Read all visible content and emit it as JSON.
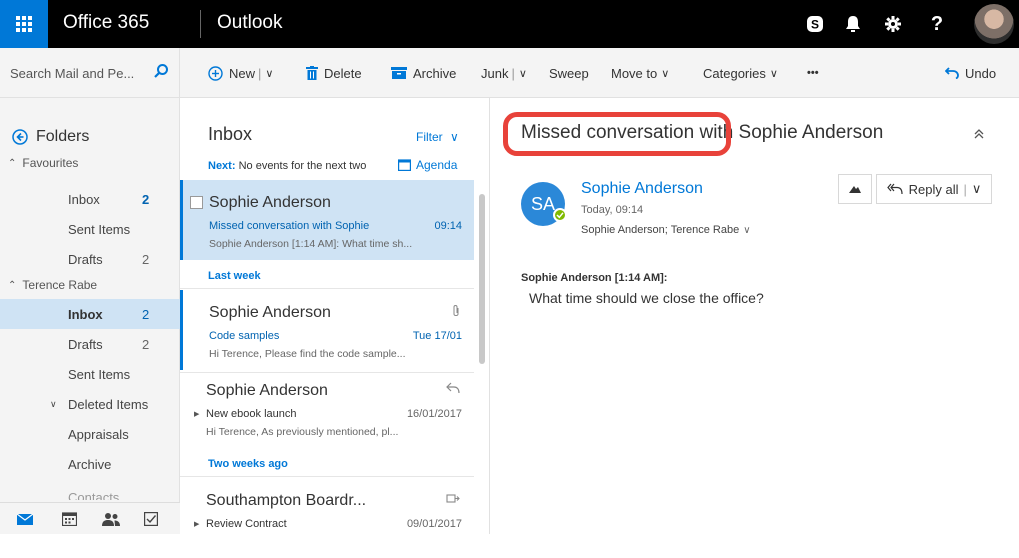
{
  "topbar": {
    "brand": "Office 365",
    "app": "Outlook",
    "icons": [
      "skype-icon",
      "bell-icon",
      "gear-icon",
      "help-icon"
    ],
    "help_label": "?"
  },
  "search": {
    "placeholder": "Search Mail and Pe..."
  },
  "commands": {
    "new": "New",
    "delete": "Delete",
    "archive": "Archive",
    "junk": "Junk",
    "sweep": "Sweep",
    "move_to": "Move to",
    "categories": "Categories",
    "more": "•••",
    "undo": "Undo"
  },
  "nav": {
    "folders_label": "Folders",
    "favourites": {
      "label": "Favourites",
      "items": [
        {
          "label": "Inbox",
          "count": "2"
        },
        {
          "label": "Sent Items",
          "count": ""
        },
        {
          "label": "Drafts",
          "count": "2"
        }
      ]
    },
    "account": {
      "label": "Terence Rabe",
      "items": [
        {
          "label": "Inbox",
          "count": "2"
        },
        {
          "label": "Drafts",
          "count": "2"
        },
        {
          "label": "Sent Items",
          "count": ""
        },
        {
          "label": "Deleted Items",
          "count": ""
        },
        {
          "label": "Appraisals",
          "count": ""
        },
        {
          "label": "Archive",
          "count": ""
        },
        {
          "label": "Contacts",
          "count": ""
        }
      ]
    }
  },
  "list": {
    "title": "Inbox",
    "filter": "Filter",
    "next_label": "Next:",
    "next_text": "No events for the next two",
    "agenda": "Agenda",
    "sections": [
      "Last week",
      "Two weeks ago"
    ],
    "messages": [
      {
        "from": "Sophie Anderson",
        "subject": "Missed conversation with Sophie",
        "time": "09:14",
        "preview": "Sophie Anderson [1:14 AM]: What time sh..."
      },
      {
        "from": "Sophie Anderson",
        "subject": "Code samples",
        "time": "Tue 17/01",
        "preview": "Hi Terence,  Please find the code sample..."
      },
      {
        "from": "Sophie Anderson",
        "subject": "New ebook launch",
        "time": "16/01/2017",
        "preview": "Hi Terence,  As previously mentioned, pl..."
      },
      {
        "from": "Southampton Boardr...",
        "subject": "Review Contract",
        "time": "09/01/2017",
        "preview": ""
      }
    ]
  },
  "reading": {
    "subject": "Missed conversation with Sophie Anderson",
    "initials": "SA",
    "from": "Sophie Anderson",
    "date": "Today, 09:14",
    "to": "Sophie Anderson; Terence Rabe",
    "reply_all": "Reply all",
    "body_header": "Sophie Anderson [1:14 AM]:",
    "body": "What time should we close the office?"
  },
  "colors": {
    "accent": "#0078d7",
    "selection": "#cfe3f4",
    "highlight": "#e8423a",
    "topbar": "#000000"
  }
}
